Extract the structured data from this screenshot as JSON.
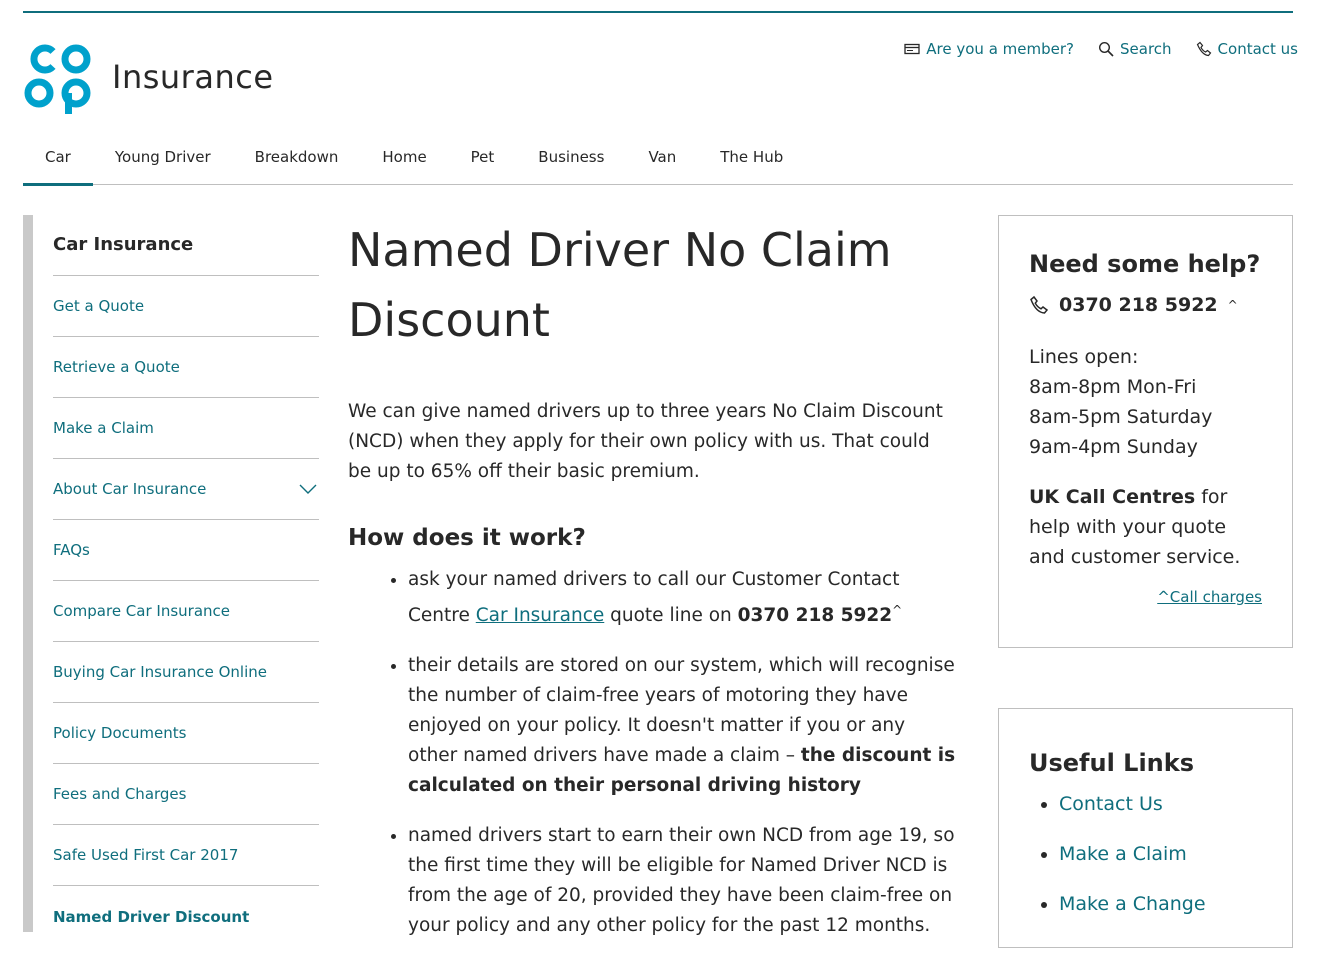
{
  "brand": {
    "logo_text": "co op",
    "name": "Insurance",
    "colors": {
      "logo": "#00a1cc",
      "accent": "#0f6e7d",
      "text": "#282828",
      "divider": "#bfbfbf"
    }
  },
  "utility_nav": [
    {
      "label": "Are you a member?",
      "icon": "membership-card-icon"
    },
    {
      "label": "Search",
      "icon": "search-icon"
    },
    {
      "label": "Contact us",
      "icon": "phone-icon"
    }
  ],
  "main_nav": [
    {
      "label": "Car",
      "active": true
    },
    {
      "label": "Young Driver"
    },
    {
      "label": "Breakdown"
    },
    {
      "label": "Home"
    },
    {
      "label": "Pet"
    },
    {
      "label": "Business"
    },
    {
      "label": "Van"
    },
    {
      "label": "The Hub"
    }
  ],
  "sidebar": {
    "title": "Car Insurance",
    "items": [
      {
        "label": "Get a Quote"
      },
      {
        "label": "Retrieve a Quote"
      },
      {
        "label": "Make a Claim"
      },
      {
        "label": "About Car Insurance",
        "expandable": true
      },
      {
        "label": "FAQs"
      },
      {
        "label": "Compare Car Insurance"
      },
      {
        "label": "Buying Car Insurance Online"
      },
      {
        "label": "Policy Documents"
      },
      {
        "label": "Fees and Charges"
      },
      {
        "label": "Safe Used First Car 2017"
      },
      {
        "label": "Named Driver Discount",
        "current": true
      }
    ]
  },
  "content": {
    "title": "Named Driver No Claim Discount",
    "lead": "We can give named drivers up to three years No Claim Discount (NCD) when they apply for their own policy with us. That could be up to 65% off their basic premium.",
    "section_title": "How does it work?",
    "step1": {
      "before": "ask your named drivers to call our Customer Contact Centre ",
      "link": "Car Insurance",
      "middle": " quote line on ",
      "phone": "0370 218 5922",
      "mark": "^"
    },
    "step2": {
      "text": "their details are stored on our system, which will recognise the number of claim-free years of motoring they have enjoyed on your policy. It doesn't matter if you or any other named drivers have made a claim – ",
      "bold": "the discount is calculated on their personal driving history"
    },
    "step3": {
      "text": "named drivers start to earn their own NCD from age 19, so the first time they will be eligible for Named Driver NCD is from the age of 20, provided they have been claim-free on your policy and any other policy for the past 12 months."
    }
  },
  "help_box": {
    "title": "Need some help?",
    "phone": "0370 218 5922",
    "mark": "^",
    "lines_label": "Lines open:",
    "hours": [
      "8am-8pm Mon-Fri",
      "8am-5pm Saturday",
      "9am-4pm Sunday"
    ],
    "centres_bold": "UK Call Centres",
    "centres_text": " for help with your quote and customer service.",
    "charges_link": "^Call charges"
  },
  "useful_links": {
    "title": "Useful Links",
    "items": [
      "Contact Us",
      "Make a Claim",
      "Make a Change"
    ]
  }
}
